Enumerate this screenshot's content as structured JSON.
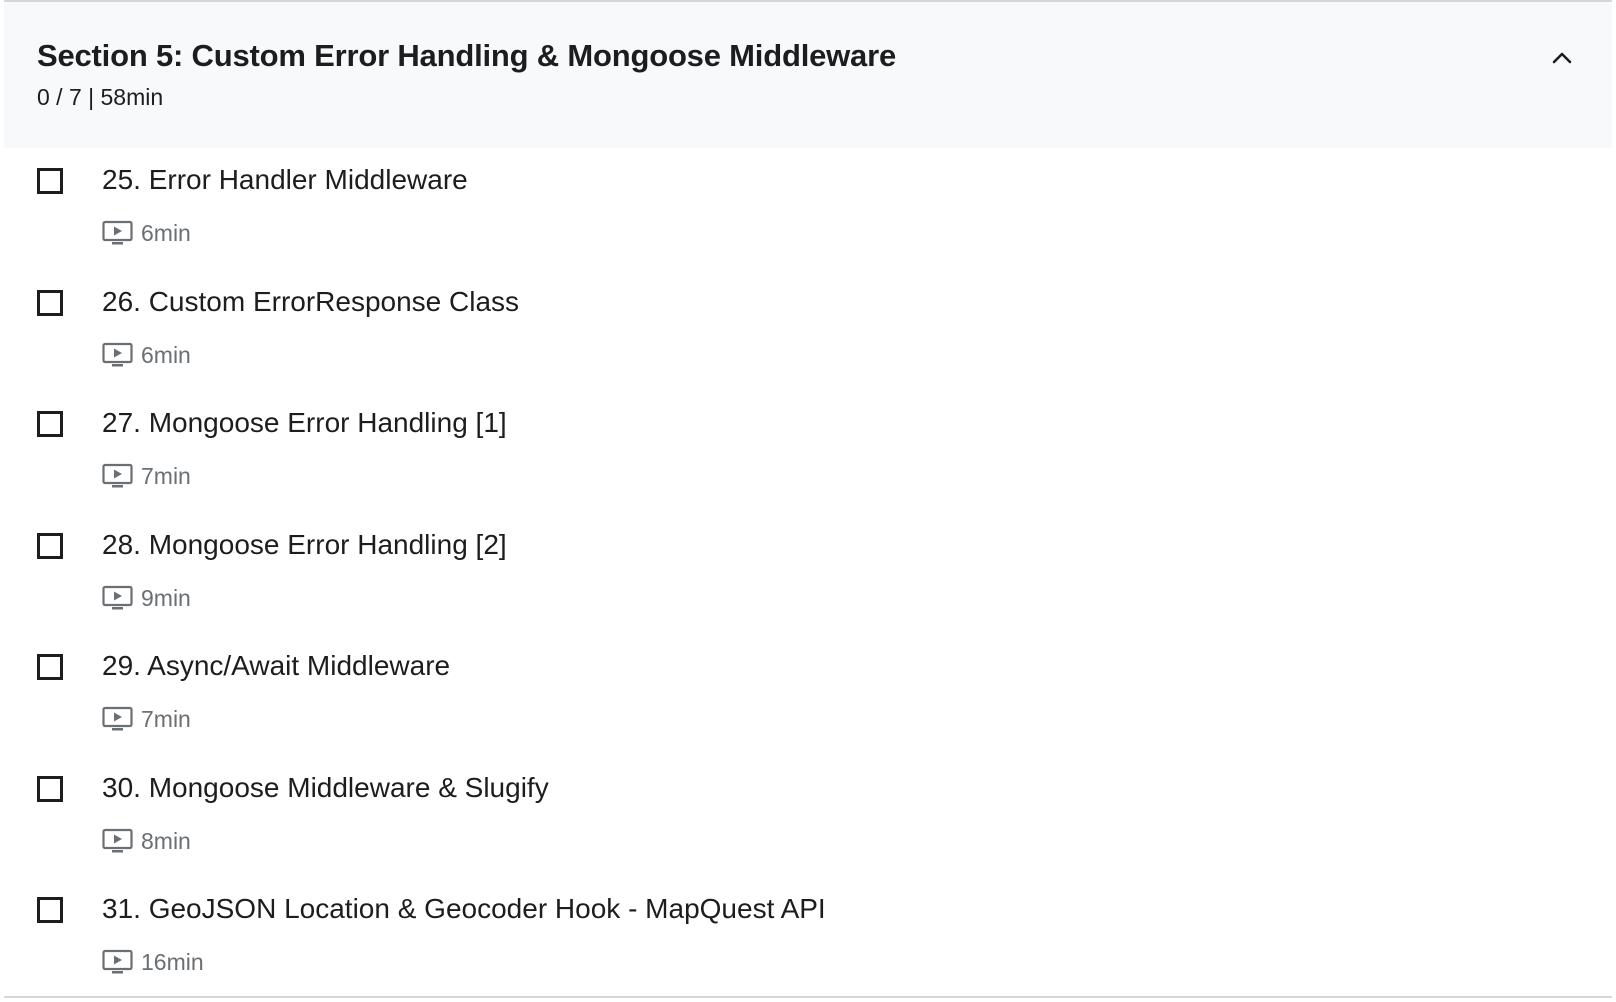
{
  "section": {
    "title": "Section 5: Custom Error Handling & Mongoose Middleware",
    "meta": "0 / 7 | 58min",
    "collapse_icon": "chevron-up-icon"
  },
  "lectures": [
    {
      "title": "25. Error Handler Middleware",
      "duration": "6min",
      "completed": false,
      "icon": "video-icon"
    },
    {
      "title": "26. Custom ErrorResponse Class",
      "duration": "6min",
      "completed": false,
      "icon": "video-icon"
    },
    {
      "title": "27. Mongoose Error Handling [1]",
      "duration": "7min",
      "completed": false,
      "icon": "video-icon"
    },
    {
      "title": "28. Mongoose Error Handling [2]",
      "duration": "9min",
      "completed": false,
      "icon": "video-icon"
    },
    {
      "title": "29. Async/Await Middleware",
      "duration": "7min",
      "completed": false,
      "icon": "video-icon"
    },
    {
      "title": "30. Mongoose Middleware & Slugify",
      "duration": "8min",
      "completed": false,
      "icon": "video-icon"
    },
    {
      "title": "31. GeoJSON Location & Geocoder Hook - MapQuest API",
      "duration": "16min",
      "completed": false,
      "icon": "video-icon"
    }
  ],
  "colors": {
    "header_bg": "#f7f9fa",
    "text": "#1c1d1f",
    "muted_text": "#6a6f73",
    "border": "#d1d7dc"
  }
}
